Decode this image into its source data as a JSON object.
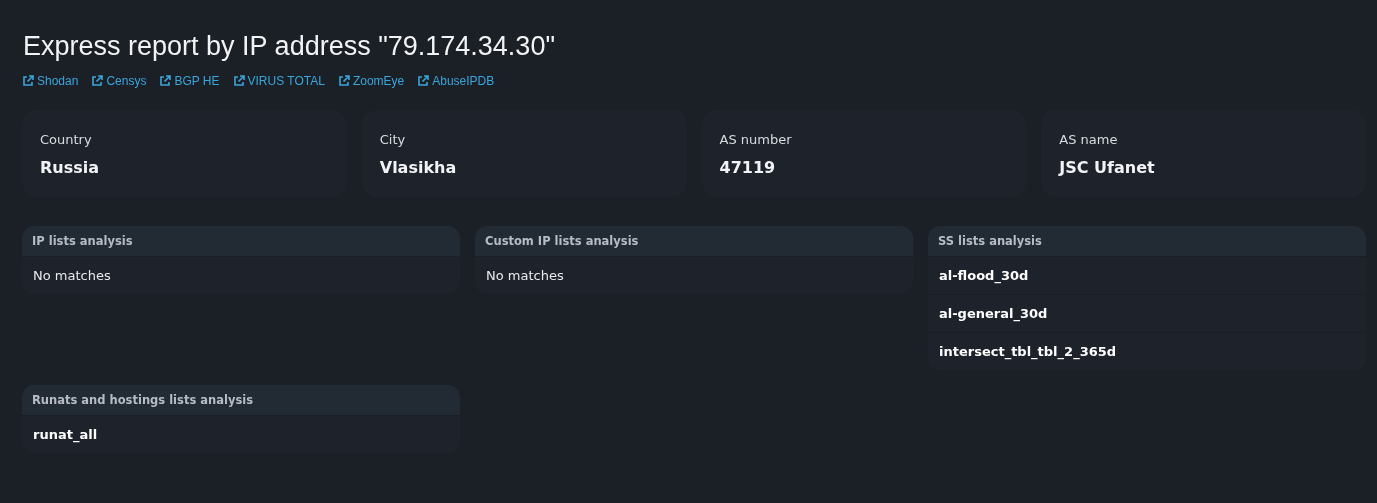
{
  "title": "Express report by IP address \"79.174.34.30\"",
  "links": [
    "Shodan",
    "Censys",
    "BGP HE",
    "VIRUS TOTAL",
    "ZoomEye",
    "AbuseIPDB"
  ],
  "info_cards": [
    {
      "label": "Country",
      "value": "Russia"
    },
    {
      "label": "City",
      "value": "Vlasikha"
    },
    {
      "label": "AS number",
      "value": "47119"
    },
    {
      "label": "AS name",
      "value": "JSC Ufanet"
    }
  ],
  "panels": [
    {
      "title": "IP lists analysis",
      "rows": [
        {
          "kind": "empty",
          "text": "No matches"
        }
      ]
    },
    {
      "title": "Custom IP lists analysis",
      "rows": [
        {
          "kind": "empty",
          "text": "No matches"
        }
      ]
    },
    {
      "title": "SS lists analysis",
      "rows": [
        {
          "kind": "match",
          "text": "al-flood_30d"
        },
        {
          "kind": "match",
          "text": "al-general_30d"
        },
        {
          "kind": "match",
          "text": "intersect_tbl_tbl_2_365d"
        }
      ]
    },
    {
      "title": "Runats and hostings lists analysis",
      "rows": [
        {
          "kind": "match",
          "text": "runat_all"
        }
      ]
    }
  ]
}
